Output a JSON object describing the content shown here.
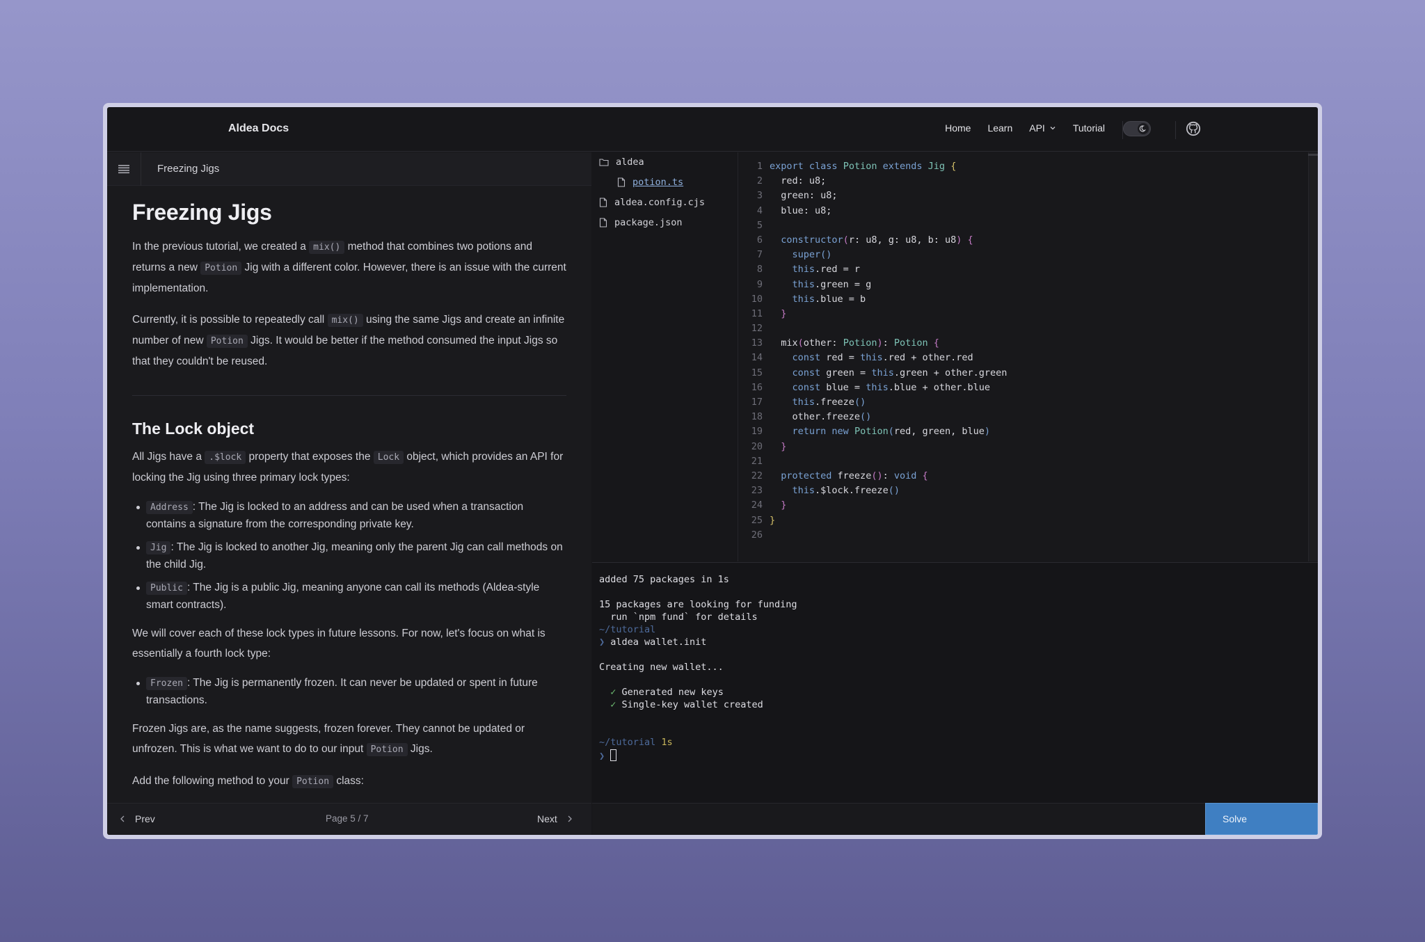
{
  "nav": {
    "brand": "Aldea Docs",
    "links": [
      "Home",
      "Learn",
      "API",
      "Tutorial"
    ],
    "theme_icon": "moon-icon",
    "github_icon": "github-icon"
  },
  "doc": {
    "bar_title": "Freezing Jigs",
    "h1": "Freezing Jigs",
    "p1": {
      "a": "In the previous tutorial, we created a ",
      "c1": "mix()",
      "b": " method that combines two potions and returns a new ",
      "c2": "Potion",
      "c": " Jig with a different color. However, there is an issue with the current implementation."
    },
    "p2": {
      "a": "Currently, it is possible to repeatedly call ",
      "c1": "mix()",
      "b": " using the same Jigs and create an infinite number of new ",
      "c2": "Potion",
      "c": " Jigs. It would be better if the method consumed the input Jigs so that they couldn't be reused."
    },
    "h2": "The Lock object",
    "p3": {
      "a": "All Jigs have a ",
      "c1": ".$lock",
      "b": " property that exposes the ",
      "c2": "Lock",
      "c": " object, which provides an API for locking the Jig using three primary lock types:"
    },
    "locks": [
      {
        "code": "Address",
        "text": ": The Jig is locked to an address and can be used when a transaction contains a signature from the corresponding private key."
      },
      {
        "code": "Jig",
        "text": ": The Jig is locked to another Jig, meaning only the parent Jig can call methods on the child Jig."
      },
      {
        "code": "Public",
        "text": ": The Jig is a public Jig, meaning anyone can call its methods (Aldea-style smart contracts)."
      }
    ],
    "p4": "We will cover each of these lock types in future lessons. For now, let's focus on what is essentially a fourth lock type:",
    "frozen": {
      "code": "Frozen",
      "text": ": The Jig is permanently frozen. It can never be updated or spent in future transactions."
    },
    "p5": {
      "a": "Frozen Jigs are, as the name suggests, frozen forever. They cannot be updated or unfrozen. This is what we want to do to our input ",
      "c1": "Potion",
      "b": " Jigs."
    },
    "p6": {
      "a": "Add the following method to your ",
      "c1": "Potion",
      "b": " class:"
    }
  },
  "pager": {
    "prev": "Prev",
    "page": "Page 5 / 7",
    "next": "Next"
  },
  "tree": {
    "folder": "aldea",
    "files": [
      "potion.ts",
      "aldea.config.cjs",
      "package.json"
    ]
  },
  "terminal": {
    "l1": "added 75 packages in 1s",
    "l2": "15 packages are looking for funding",
    "l3": "  run `npm fund` for details",
    "l4": "~/tutorial",
    "l5": "aldea wallet.init",
    "l6": "Creating new wallet...",
    "l7": "Generated new keys",
    "l8": "Single-key wallet created",
    "l9a": "~/tutorial",
    "l9b": "1s"
  },
  "solve": "Solve"
}
